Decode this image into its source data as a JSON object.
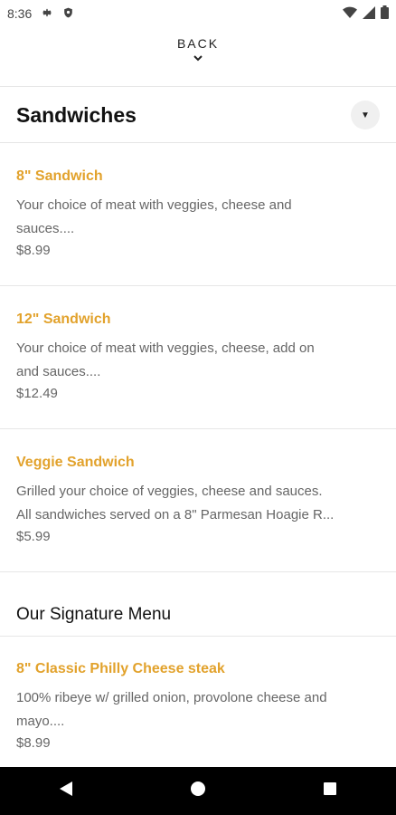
{
  "status": {
    "time": "8:36"
  },
  "back_label": "BACK",
  "section": {
    "title": "Sandwiches"
  },
  "items": [
    {
      "name": "8\" Sandwich",
      "desc_line1": "Your choice of meat with veggies, cheese and",
      "desc_line2": "sauces....",
      "price": "$8.99"
    },
    {
      "name": "12\" Sandwich",
      "desc_line1": "Your choice of meat with veggies, cheese, add on",
      "desc_line2": "and sauces....",
      "price": "$12.49"
    },
    {
      "name": "Veggie Sandwich",
      "desc_line1": "Grilled your choice of veggies, cheese and sauces.",
      "desc_line2": "All sandwiches served on a 8\" Parmesan Hoagie R...",
      "price": "$5.99"
    }
  ],
  "signature": {
    "title": "Our Signature Menu",
    "items": [
      {
        "name": "8\" Classic Philly Cheese steak",
        "desc_line1": "100% ribeye w/ grilled onion, provolone cheese and",
        "desc_line2": "mayo....",
        "price": "$8.99"
      }
    ]
  }
}
